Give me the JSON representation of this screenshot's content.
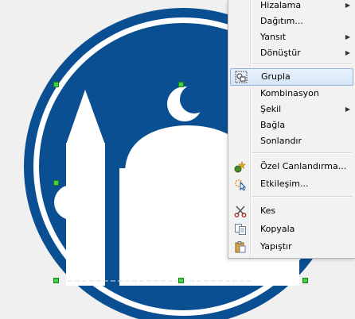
{
  "context_menu": {
    "items": [
      {
        "label": "Hizalama",
        "has_submenu": true
      },
      {
        "label": "Dağıtım...",
        "has_submenu": false
      },
      {
        "label": "Yansıt",
        "has_submenu": true
      },
      {
        "label": "Dönüştür",
        "has_submenu": true
      },
      {
        "label": "Grupla",
        "has_submenu": false,
        "highlighted": true
      },
      {
        "label": "Kombinasyon",
        "has_submenu": false
      },
      {
        "label": "Şekil",
        "has_submenu": true
      },
      {
        "label": "Bağla",
        "has_submenu": false
      },
      {
        "label": "Sonlandır",
        "has_submenu": false
      },
      {
        "label": "Özel Canlandırma...",
        "has_submenu": false
      },
      {
        "label": "Etkileşim...",
        "has_submenu": false
      },
      {
        "label": "Kes",
        "has_submenu": false
      },
      {
        "label": "Kopyala",
        "has_submenu": false
      },
      {
        "label": "Yapıştır",
        "has_submenu": false
      }
    ],
    "submenu_arrow": "▶"
  },
  "colors": {
    "sign_blue": "#0a4f92",
    "sign_white": "#ffffff",
    "handle_green": "#3fd43f",
    "menu_bg": "#f2f2f2",
    "highlight_border": "#92b5df"
  },
  "icons": {
    "group": "group-icon",
    "custom_animation": "custom-animation-icon",
    "interaction": "interaction-icon",
    "cut": "scissors-icon",
    "copy": "copy-icon",
    "paste": "paste-icon"
  }
}
